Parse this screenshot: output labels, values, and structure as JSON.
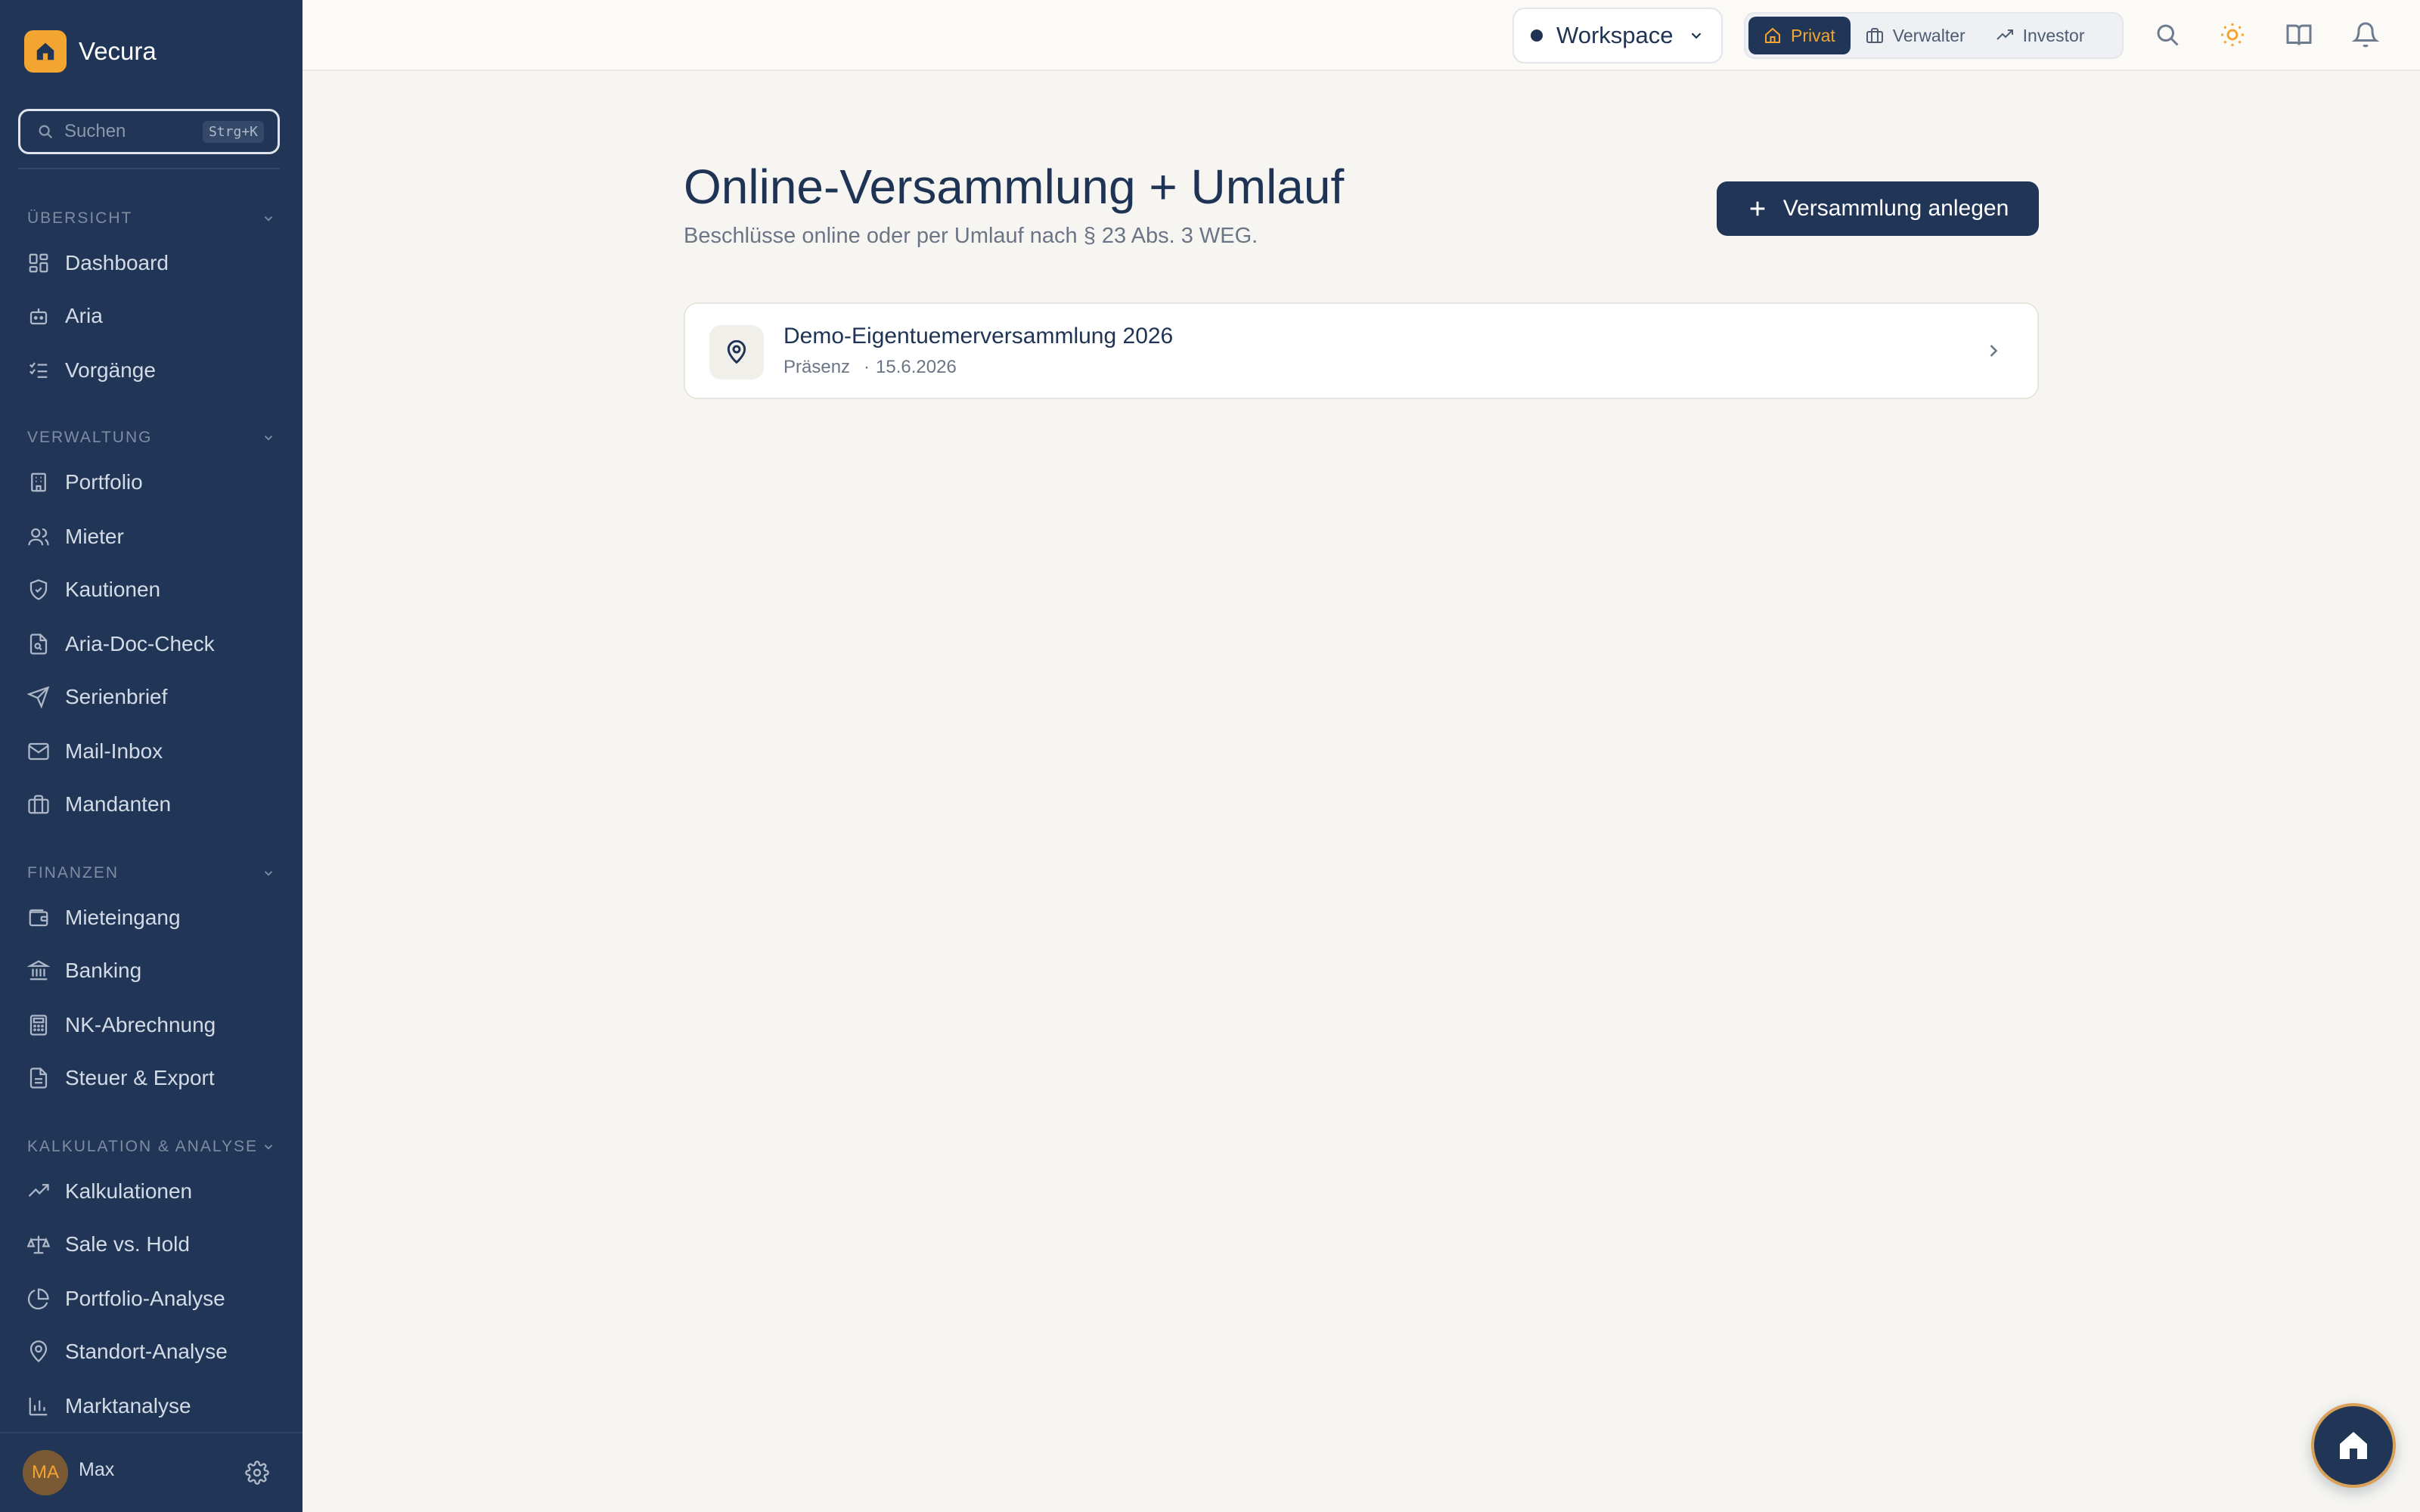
{
  "brand": {
    "name": "Vecura"
  },
  "search": {
    "placeholder": "Suchen",
    "shortcut": "Strg+K"
  },
  "sidebar": {
    "sections": [
      {
        "title": "ÜBERSICHT",
        "items": [
          "Dashboard",
          "Aria",
          "Vorgänge"
        ]
      },
      {
        "title": "VERWALTUNG",
        "items": [
          "Portfolio",
          "Mieter",
          "Kautionen",
          "Aria-Doc-Check",
          "Serienbrief",
          "Mail-Inbox",
          "Mandanten"
        ]
      },
      {
        "title": "FINANZEN",
        "items": [
          "Mieteingang",
          "Banking",
          "NK-Abrechnung",
          "Steuer & Export"
        ]
      },
      {
        "title": "KALKULATION & ANALYSE",
        "items": [
          "Kalkulationen",
          "Sale vs. Hold",
          "Portfolio-Analyse",
          "Standort-Analyse",
          "Marktanalyse"
        ]
      }
    ],
    "user": {
      "initials": "MA",
      "name": "Max"
    }
  },
  "topbar": {
    "workspace": "Workspace",
    "roles": [
      "Privat",
      "Verwalter",
      "Investor"
    ],
    "active_role": "Privat"
  },
  "main": {
    "title": "Online-Versammlung + Umlauf",
    "subtitle": "Beschlüsse online oder per Umlauf nach § 23 Abs. 3 WEG.",
    "create_button": "Versammlung anlegen",
    "meetings": [
      {
        "title": "Demo-Eigentuemerversammlung 2026",
        "type": "Präsenz",
        "separator": "·",
        "date": "15.6.2026"
      }
    ]
  },
  "colors": {
    "sidebar_bg": "#213657",
    "accent": "#f2a531",
    "page_bg": "#f6f5f1",
    "primary": "#213657"
  },
  "icons": {
    "brand": "house-icon",
    "search": "search-icon",
    "settings": "gear-icon",
    "topbar": [
      "search-icon",
      "sun-icon",
      "book-icon",
      "bell-icon"
    ],
    "card": "map-pin-icon",
    "fab": "house-icon"
  }
}
